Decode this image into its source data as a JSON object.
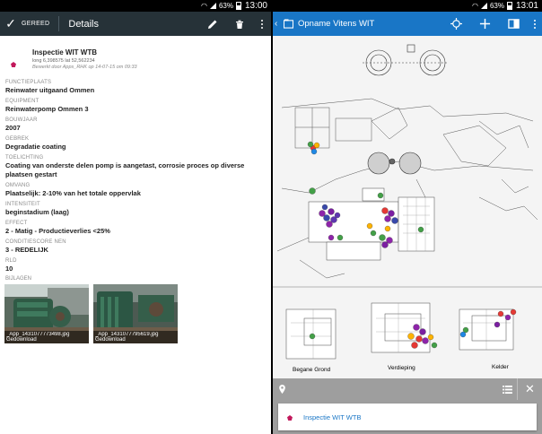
{
  "status_bar": {
    "battery": "63%",
    "left_time": "13:00",
    "right_time": "13:01"
  },
  "colors": {
    "left_toolbar": "#263238",
    "right_toolbar": "#1976c6",
    "feature_marker": "#c2185b"
  },
  "detail": {
    "toolbar": {
      "done_label": "GEREED",
      "title": "Details",
      "edit_icon": "pencil-icon",
      "delete_icon": "trash-icon"
    },
    "feature": {
      "name": "Inspectie WIT WTB",
      "coordinates": "long 6,398575 lat 52,562234",
      "edited": "Bewerkt door Apps_RHK op 14-07-15 om 09:33"
    },
    "fields": [
      {
        "label": "FUNCTIEPLAATS",
        "value": "Reinwater uitgaand Ommen"
      },
      {
        "label": "EQUIPMENT",
        "value": "Reinwaterpomp Ommen 3"
      },
      {
        "label": "BOUWJAAR",
        "value": "2007"
      },
      {
        "label": "GEBREK",
        "value": "Degradatie coating"
      },
      {
        "label": "TOELICHTING",
        "value": "Coating van onderste delen pomp is aangetast, corrosie proces op diverse plaatsen gestart"
      },
      {
        "label": "OMVANG",
        "value": "Plaatselijk: 2-10% van het totale oppervlak"
      },
      {
        "label": "INTENSITEIT",
        "value": "beginstadium (laag)"
      },
      {
        "label": "EFFECT",
        "value": "2 - Matig - Productieverlies <25%"
      },
      {
        "label": "CONDITIESCORE NEN",
        "value": "3 - REDELIJK"
      },
      {
        "label": "RLD",
        "value": "10"
      }
    ],
    "attachments_label": "BIJLAGEN",
    "attachments": [
      {
        "filename": "_App_1431077773498.jpg",
        "status": "Gedownload"
      },
      {
        "filename": "_App_1431077795619.jpg",
        "status": "Gedownload"
      }
    ]
  },
  "map": {
    "toolbar": {
      "title": "Opname Vitens WIT",
      "locate_icon": "crosshair-icon",
      "add_icon": "plus-icon",
      "layers_icon": "panel-icon"
    },
    "floor_labels": [
      "Begane Grond",
      "Verdieping",
      "Kelder"
    ],
    "result": {
      "label": "Inspectie WIT WTB"
    }
  }
}
